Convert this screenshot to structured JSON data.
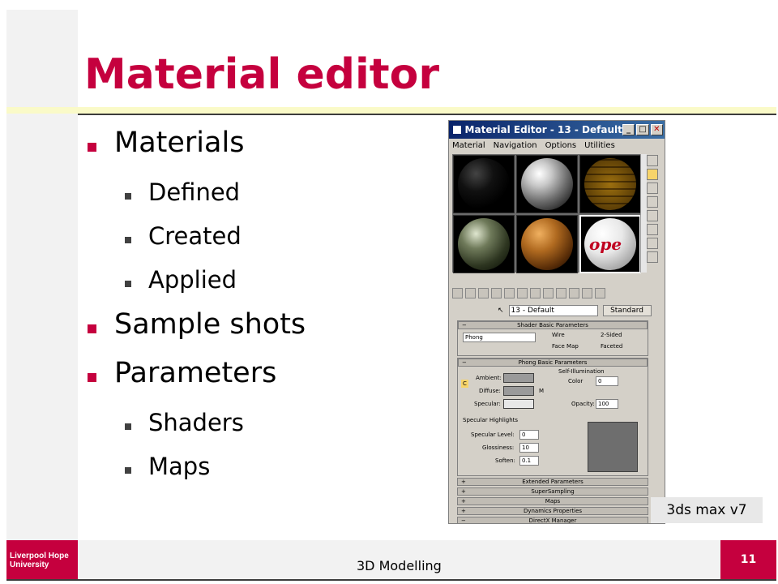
{
  "slide": {
    "title": "Material editor",
    "bullets": [
      {
        "text": "Materials",
        "level": 1
      },
      {
        "text": "Defined",
        "level": 2
      },
      {
        "text": "Created",
        "level": 2
      },
      {
        "text": "Applied",
        "level": 2
      },
      {
        "text": "Sample shots",
        "level": 1
      },
      {
        "text": "Parameters",
        "level": 1
      },
      {
        "text": "Shaders",
        "level": 2
      },
      {
        "text": "Maps",
        "level": 2
      }
    ],
    "caption": "3ds max v7"
  },
  "screenshot": {
    "title": "Material Editor - 13 - Default",
    "menu": [
      "Material",
      "Navigation",
      "Options",
      "Utilities"
    ],
    "sample_text": "ope",
    "material_name": "13 - Default",
    "material_type": "Standard",
    "rollouts": {
      "shader_basic": "Shader Basic Parameters",
      "phong_basic": "Phong Basic Parameters",
      "extended": "Extended Parameters",
      "supersampling": "SuperSampling",
      "maps": "Maps",
      "dynamics": "Dynamics Properties",
      "directx": "DirectX Manager"
    },
    "shader": {
      "type": "Phong",
      "wire": "Wire",
      "two_sided": "2-Sided",
      "face_map": "Face Map",
      "faceted": "Faceted"
    },
    "phong": {
      "ambient": "Ambient:",
      "diffuse": "Diffuse:",
      "specular": "Specular:",
      "self_illum": "Self-Illumination",
      "color": "Color",
      "color_value": "0",
      "opacity": "Opacity:",
      "opacity_value": "100",
      "m": "M",
      "c": "C"
    },
    "highlights": {
      "group": "Specular Highlights",
      "spec_level": "Specular Level:",
      "spec_level_value": "0",
      "glossiness": "Glossiness:",
      "glossiness_value": "10",
      "soften": "Soften:",
      "soften_value": "0.1"
    }
  },
  "footer": {
    "logo_line1": "Liverpool Hope",
    "logo_line2": "University",
    "course": "3D Modelling",
    "page": "11"
  },
  "colors": {
    "accent": "#c5003e",
    "title_rule": "#fafac8"
  }
}
